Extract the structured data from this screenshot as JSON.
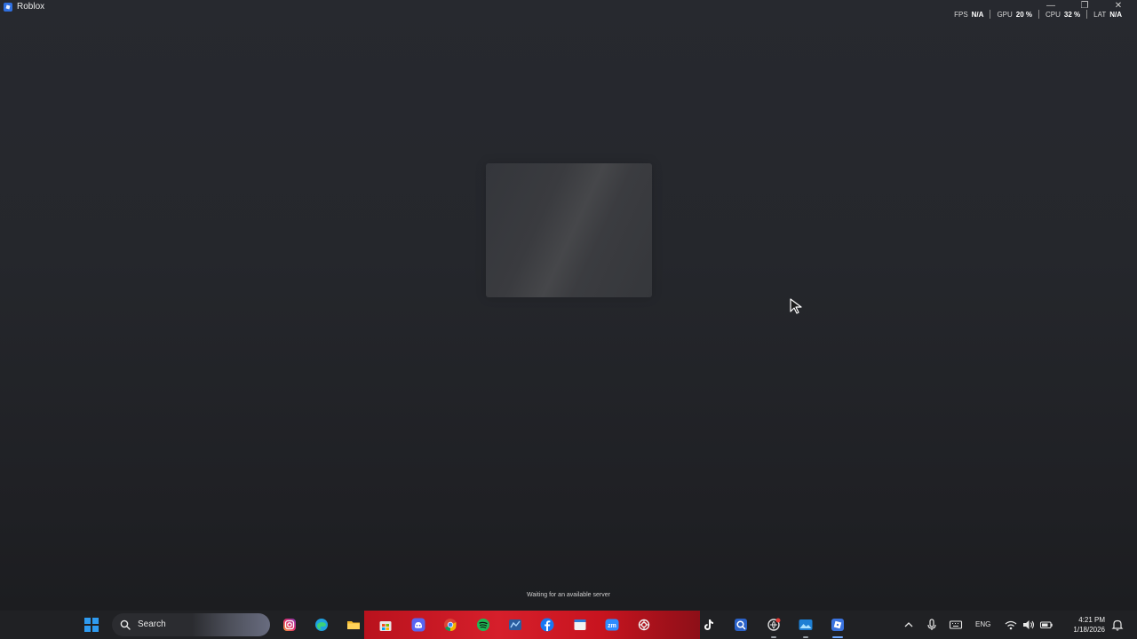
{
  "window": {
    "title": "Roblox",
    "controls": {
      "minimize": "—",
      "maximize": "❐",
      "close": "✕"
    }
  },
  "stats": [
    {
      "label": "FPS",
      "value": "N/A"
    },
    {
      "label": "GPU",
      "value": "20 %"
    },
    {
      "label": "CPU",
      "value": "32 %"
    },
    {
      "label": "LAT",
      "value": "N/A"
    }
  ],
  "status": {
    "message": "Waiting for an available server"
  },
  "taskbar": {
    "search_label": "Search",
    "apps": [
      "instagram",
      "edge",
      "file-explorer",
      "microsoft-store",
      "discord",
      "chrome",
      "spotify",
      "network-app",
      "facebook",
      "window-app",
      "zoom",
      "chatgpt",
      "tiktok",
      "search-app",
      "browser-app",
      "photos-app",
      "roblox"
    ],
    "tray": {
      "language": "ENG",
      "time": "4:21 PM",
      "date": "1/18/2026"
    }
  },
  "colors": {
    "background_top": "#27292f",
    "background_bottom": "#1b1c1f",
    "taskbar": "#202124",
    "taskbar_band": "#d61f2b",
    "accent": "#2f9bf0"
  }
}
